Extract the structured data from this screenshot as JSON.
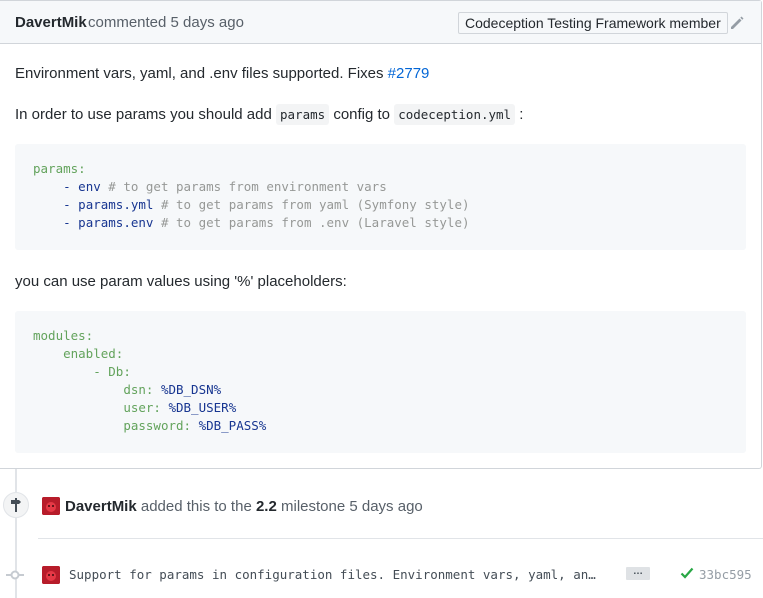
{
  "comment": {
    "author": "DavertMik",
    "meta": "commented 5 days ago",
    "badge": "Codeception Testing Framework member",
    "intro": "Environment vars, yaml, and .env files supported. Fixes ",
    "issue_link": "#2779",
    "usage_pre": "In order to use params you should add ",
    "usage_code1": "params",
    "usage_mid": " config to ",
    "usage_code2": "codeception.yml",
    "usage_post": " :",
    "code1": [
      {
        "key": "params:",
        "indent": "",
        "dash": "",
        "val": "",
        "comment": ""
      },
      {
        "key": "",
        "indent": "    ",
        "dash": "- ",
        "val": "env",
        "comment": " # to get params from environment vars"
      },
      {
        "key": "",
        "indent": "    ",
        "dash": "- ",
        "val": "params.yml",
        "comment": " # to get params from yaml (Symfony style)"
      },
      {
        "key": "",
        "indent": "    ",
        "dash": "- ",
        "val": "params.env",
        "comment": " # to get params from .env (Laravel style)"
      }
    ],
    "placeholder_text": "you can use param values using '%' placeholders:",
    "code2": {
      "l1": "modules:",
      "l2": "enabled:",
      "l3_dash": "- ",
      "l3": "Db:",
      "dsn_key": "dsn:",
      "dsn_val": "%DB_DSN%",
      "user_key": "user:",
      "user_val": "%DB_USER%",
      "pass_key": "password:",
      "pass_val": "%DB_PASS%"
    }
  },
  "events": {
    "milestone": {
      "actor": "DavertMik",
      "text_pre": " added this to the ",
      "milestone": "2.2",
      "text_post": " milestone 5 days ago"
    },
    "commit": {
      "message": "Support for params in configuration files. Environment vars, yaml, an…",
      "ellipsis": "…",
      "sha": "33bc595"
    }
  },
  "colors": {
    "link": "#0366d6",
    "yaml_key": "#63a35c",
    "yaml_value": "#183691",
    "comment": "#969896",
    "success": "#28a745",
    "avatar": "#c3212c"
  },
  "icons": {
    "edit": "pencil-icon",
    "milestone": "milestone-icon",
    "commit": "git-commit-icon",
    "status": "check-icon"
  }
}
